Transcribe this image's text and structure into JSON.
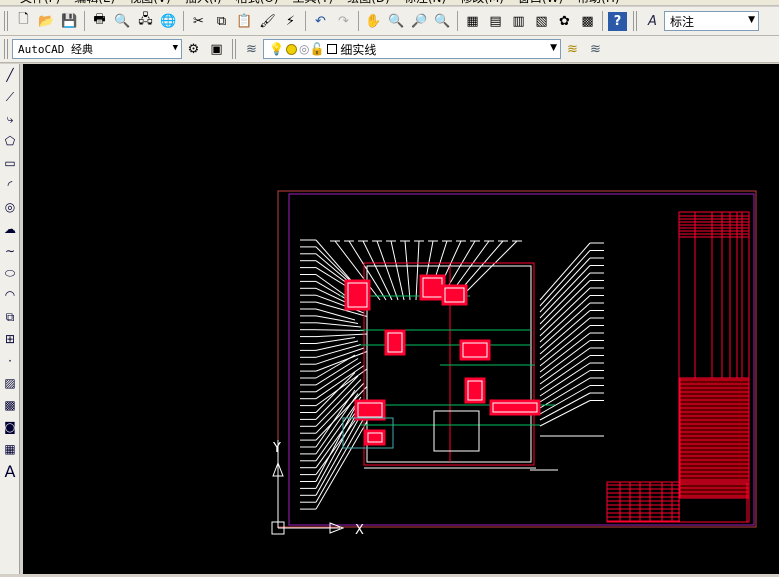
{
  "menu": [
    "文件(F)",
    "编辑(E)",
    "视图(V)",
    "插入(I)",
    "格式(O)",
    "工具(T)",
    "绘图(D)",
    "标注(N)",
    "修改(M)",
    "窗口(W)",
    "帮助(H)"
  ],
  "toolbar": {
    "workspace": "AutoCAD 经典",
    "layer": "细实线",
    "dimstyle": "标注"
  },
  "icons_top": [
    "new-icon",
    "open-icon",
    "save-icon",
    "plot-icon",
    "plot-preview-icon",
    "publish-icon",
    "3d-dwf-icon",
    "cut-icon",
    "copy-icon",
    "paste-icon",
    "match-properties-icon",
    "block-editor-icon",
    "undo-icon",
    "redo-icon",
    "pan-icon",
    "zoom-realtime-icon",
    "zoom-window-icon",
    "zoom-previous-icon",
    "properties-icon",
    "design-center-icon",
    "tool-palettes-icon",
    "sheet-set-icon",
    "markup-icon",
    "calculator-icon",
    "help-icon"
  ],
  "left_tools": [
    "line",
    "construction-line",
    "polyline",
    "polygon",
    "rectangle",
    "arc",
    "circle",
    "revision-cloud",
    "spline",
    "ellipse",
    "ellipse-arc",
    "insert-block",
    "make-block",
    "point",
    "hatch",
    "gradient",
    "region",
    "table",
    "multiline-text"
  ],
  "ucs": {
    "x_label": "X",
    "y_label": "Y"
  },
  "multiline_text_glyph": "A",
  "colors": {
    "canvas": "#000000",
    "frame": "#c04040",
    "inner_frame": "#a020c0",
    "drawing": "#ff0030",
    "leader": "#ffffff",
    "shaft": "#00c060"
  }
}
